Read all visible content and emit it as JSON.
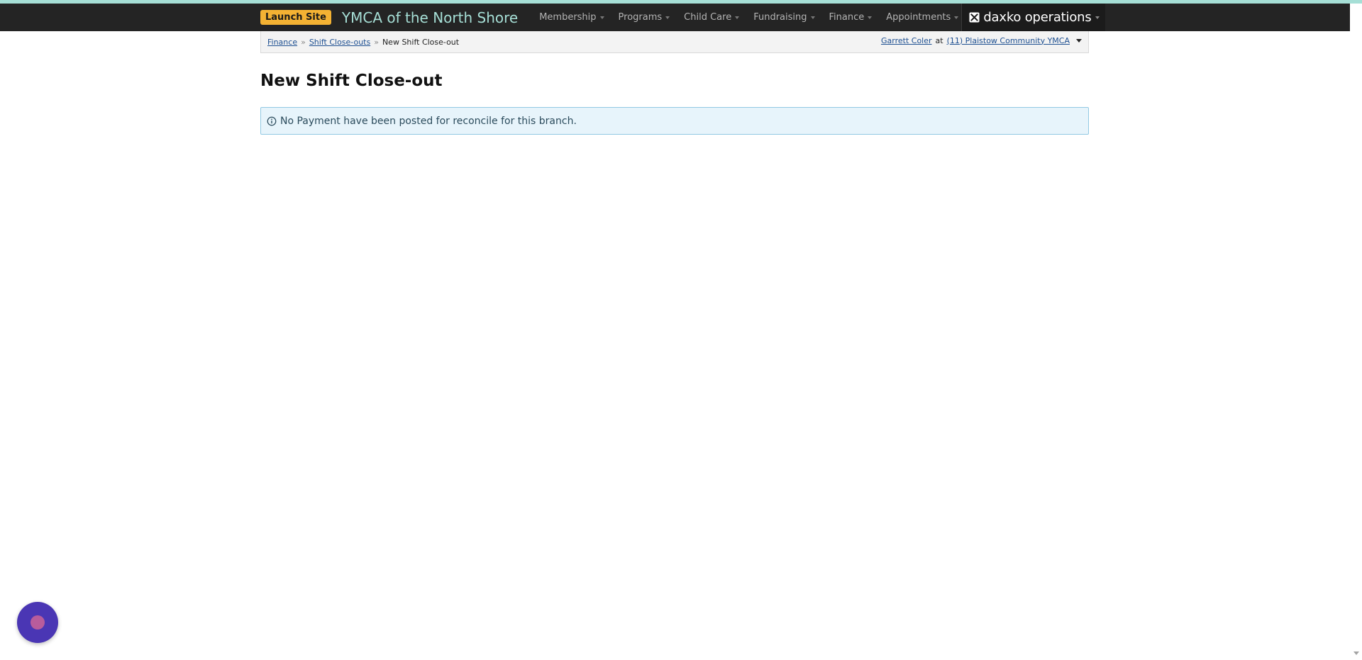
{
  "header": {
    "launch_label": "Launch Site",
    "brand_title": "YMCA of the North Shore",
    "nav": [
      {
        "label": "Membership"
      },
      {
        "label": "Programs"
      },
      {
        "label": "Child Care"
      },
      {
        "label": "Fundraising"
      },
      {
        "label": "Finance"
      },
      {
        "label": "Appointments"
      }
    ],
    "product_name": "daxko operations",
    "colors": {
      "accent_strip": "#a6dfd6",
      "bar_background": "#242424",
      "launch_button": "#f4b233",
      "brand_text": "#a6dfd6"
    }
  },
  "breadcrumb": {
    "items": [
      {
        "label": "Finance"
      },
      {
        "label": "Shift Close-outs"
      }
    ],
    "separator": "»",
    "current": "New Shift Close-out"
  },
  "user": {
    "name": "Garrett Coler",
    "at_text": "at",
    "branch": "(11) Plaistow Community YMCA"
  },
  "page": {
    "title": "New Shift Close-out"
  },
  "alert": {
    "icon": "info-icon",
    "message": "No Payment have been posted for reconcile for this branch.",
    "colors": {
      "background": "#e7f4fb",
      "border": "#92c9e3"
    }
  },
  "chat": {
    "icon": "chat-launcher-icon",
    "color": "#4a36b4"
  }
}
